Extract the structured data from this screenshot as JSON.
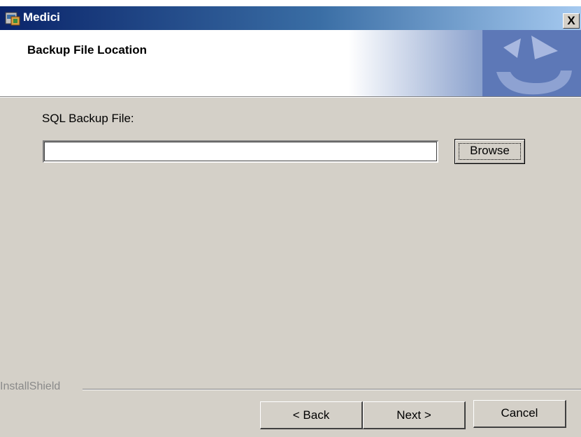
{
  "window": {
    "title": "Medici",
    "close_label": "X"
  },
  "banner": {
    "title": "Backup File Location"
  },
  "form": {
    "sql_label": "SQL Backup File:",
    "sql_value": "",
    "browse_label": "Browse"
  },
  "footer": {
    "brand": "InstallShield",
    "back_label": "< Back",
    "next_label": "Next >",
    "cancel_label": "Cancel"
  },
  "colors": {
    "titlebar_start": "#0a246a",
    "dialog_bg": "#d4d0c8",
    "banner_art": "#5d78b7"
  }
}
